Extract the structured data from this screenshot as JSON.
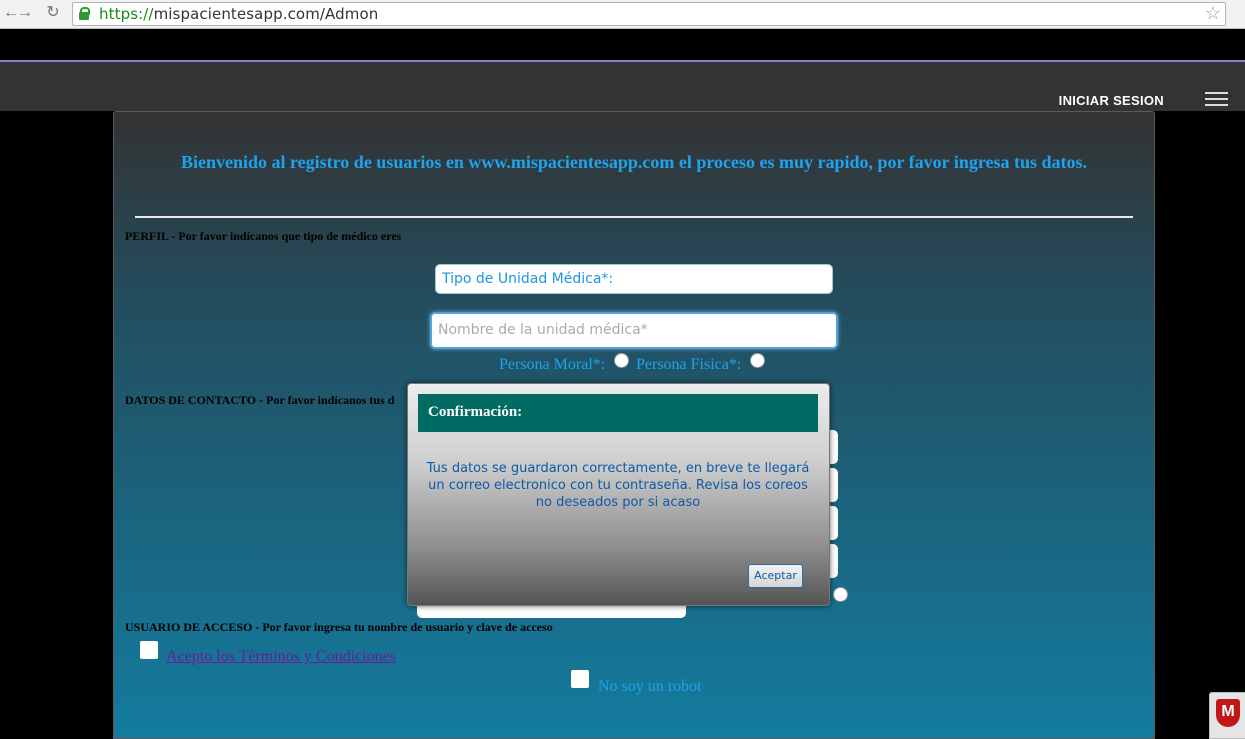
{
  "browser": {
    "url_scheme": "https://",
    "url_rest": "mispacientesapp.com/Admon"
  },
  "site_nav": {
    "login_label": "INICIAR SESION"
  },
  "form": {
    "welcome_text": "Bienvenido al registro de usuarios en www.mispacientesapp.com el proceso es muy rapido, por favor ingresa tus datos.",
    "profile_section": "PERFIL - Por favor indícanos que tipo de médico eres",
    "tipo_unidad_label": "Tipo de Unidad Médica*:",
    "nombre_unidad_placeholder": "Nombre de la unidad médica*",
    "persona_moral_label": "Persona Moral*:",
    "persona_fisica_label": "Persona Fisica*:",
    "contact_section": "DATOS DE CONTACTO - Por favor indícanos tus d",
    "access_section": "USUARIO DE ACCESO - Por favor ingresa tu nombre de usuario y clave de acceso",
    "terms_label": "Acepto los Términos y Condiciones",
    "robot_label": "No soy un robot"
  },
  "dialog": {
    "title": "Confirmación:",
    "message": "Tus datos se guardaron correctamente, en breve te llegará un correo electronico con tu contraseña. Revisa los coreos no deseados por si acaso",
    "ok_label": "Aceptar"
  },
  "colors": {
    "accent_text": "#1ea3ec",
    "dialog_header": "#006b62",
    "link": "#6a1a9a"
  },
  "icons": [
    "back-arrow-icon",
    "forward-arrow-icon",
    "reload-icon",
    "lock-icon",
    "bookmark-star-icon",
    "hamburger-menu-icon",
    "mcafee-icon"
  ]
}
